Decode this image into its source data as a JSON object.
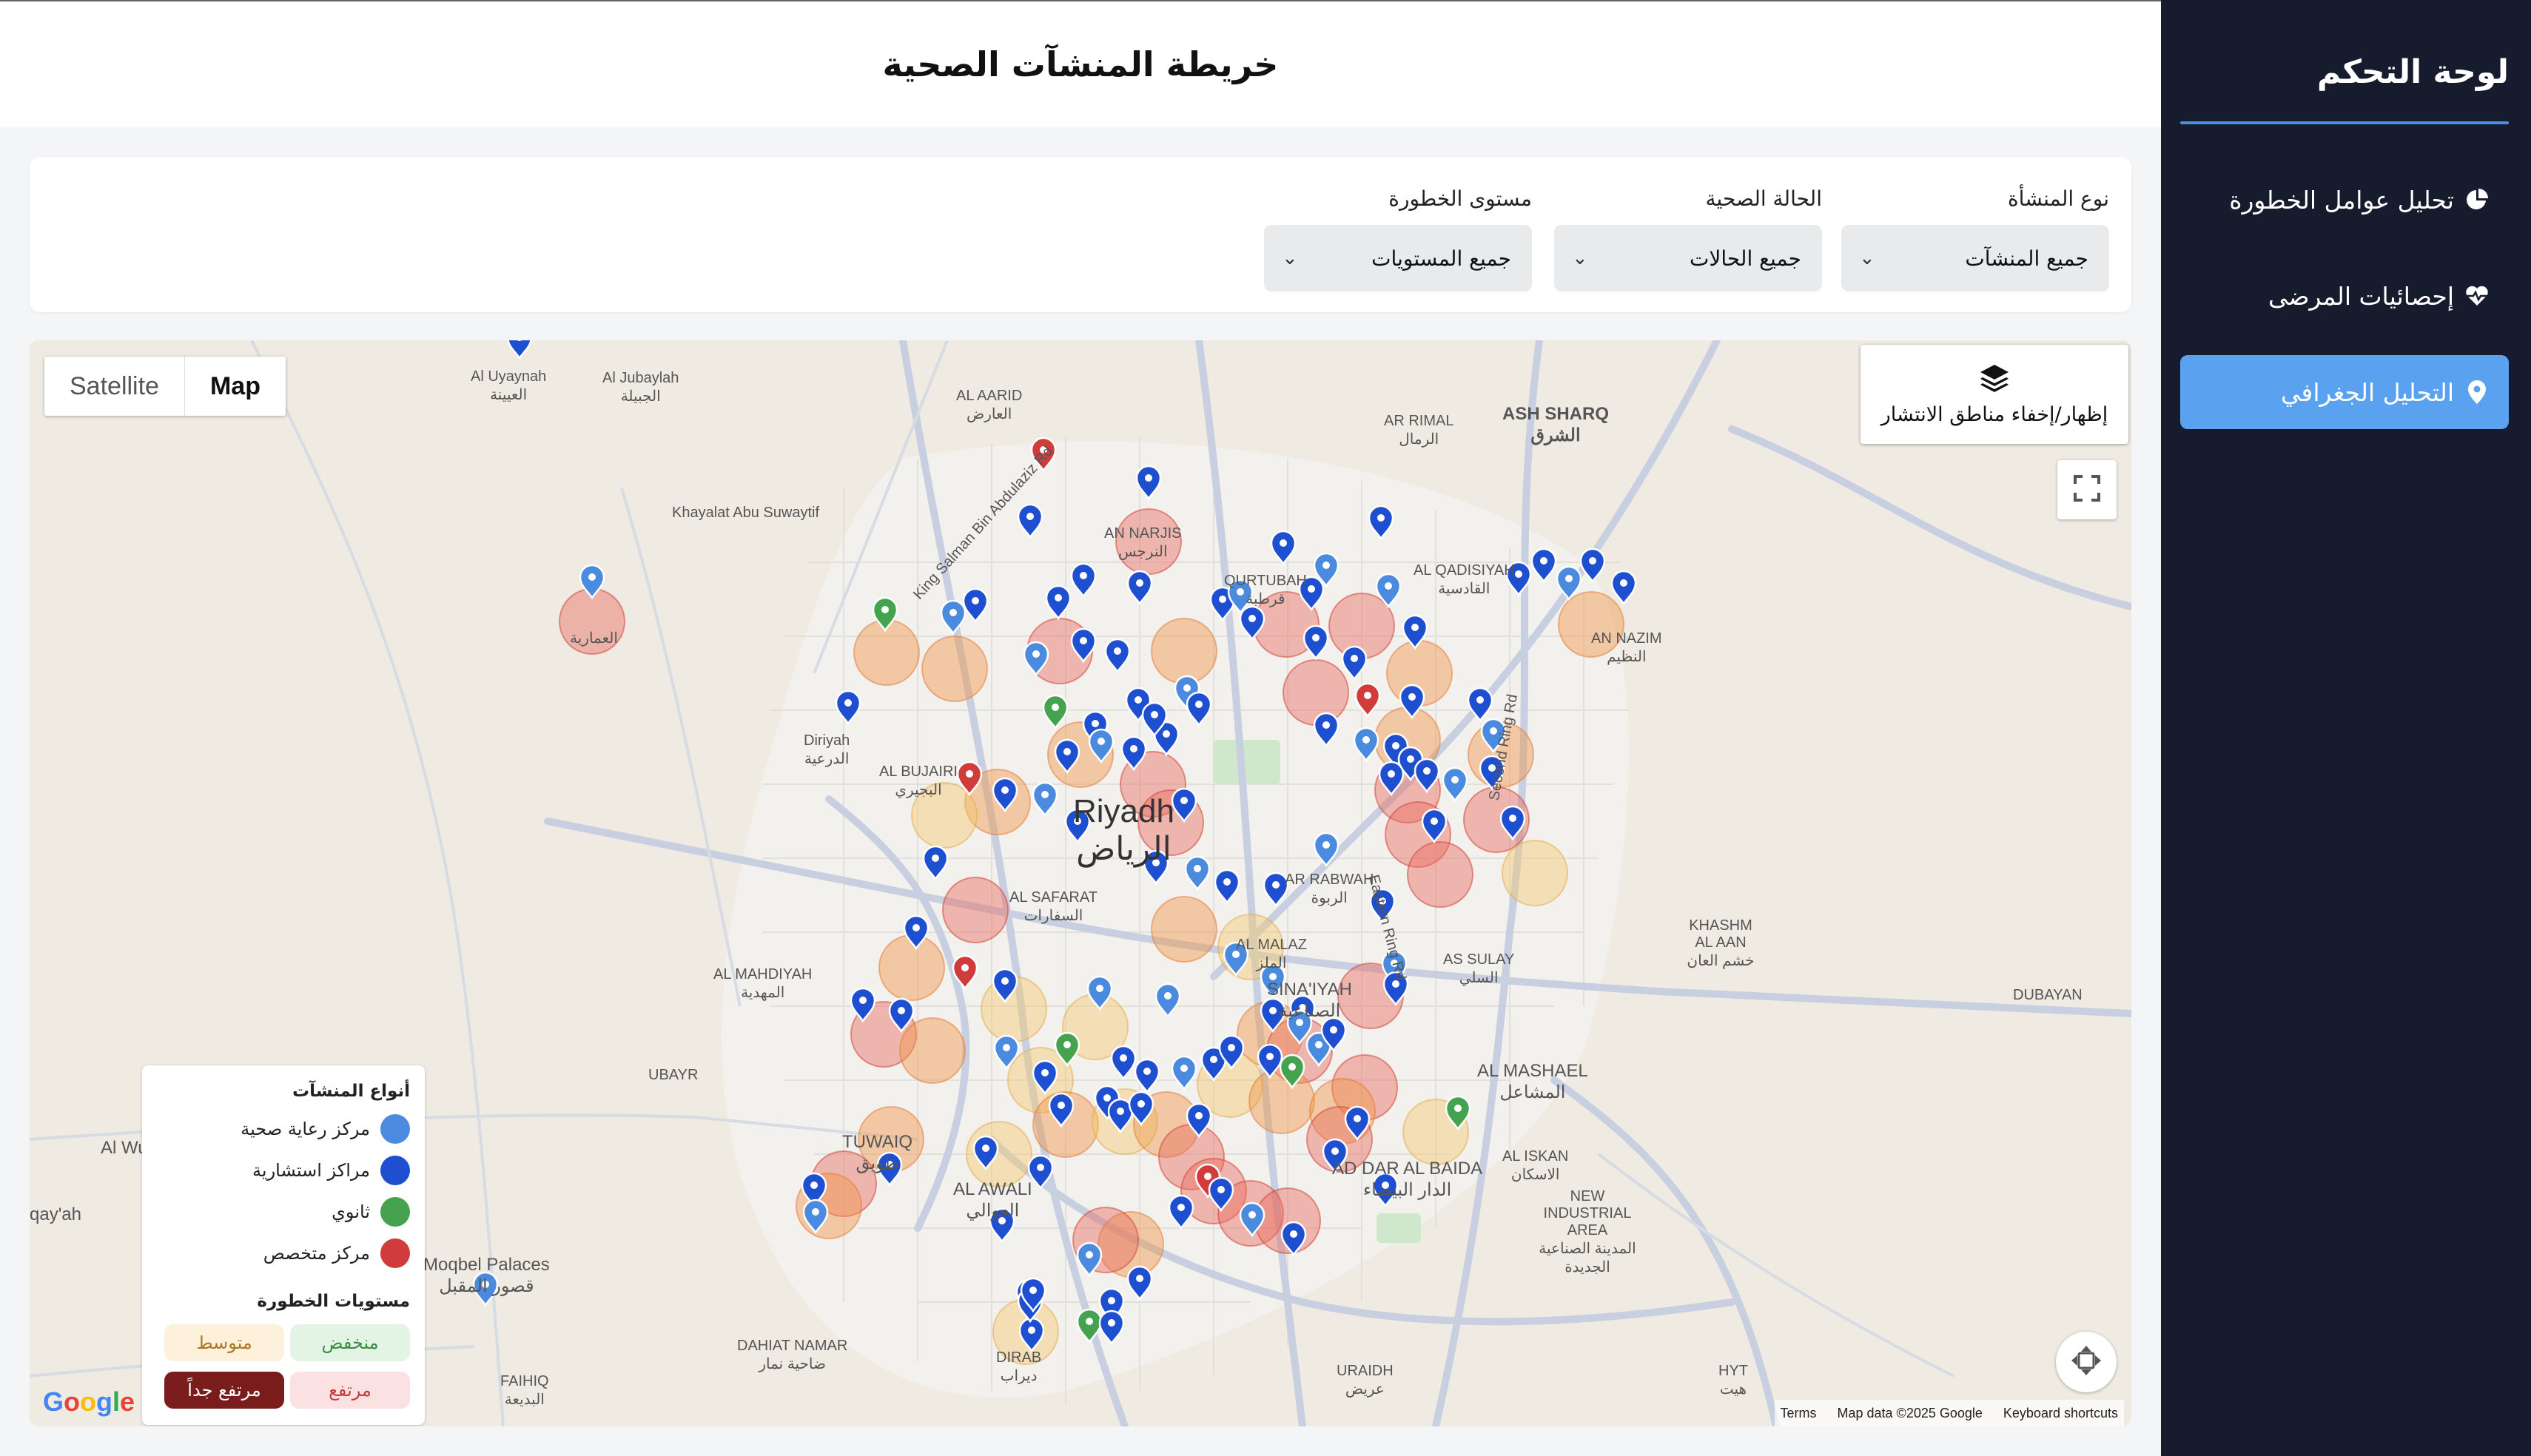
{
  "sidebar": {
    "title": "لوحة التحكم",
    "items": [
      {
        "label": "تحليل عوامل الخطورة",
        "icon": "pie-chart-icon",
        "active": false
      },
      {
        "label": "إحصائيات المرضى",
        "icon": "heart-pulse-icon",
        "active": false
      },
      {
        "label": "التحليل الجغرافي",
        "icon": "map-marker-icon",
        "active": true
      }
    ]
  },
  "header": {
    "title": "خريطة المنشآت الصحية"
  },
  "filters": {
    "facility_type": {
      "label": "نوع المنشأة",
      "value": "جميع المنشآت"
    },
    "health_status": {
      "label": "الحالة الصحية",
      "value": "جميع الحالات"
    },
    "risk_level": {
      "label": "مستوى الخطورة",
      "value": "جميع المستويات"
    }
  },
  "map": {
    "type_control": {
      "satellite": "Satellite",
      "map": "Map",
      "selected": "Map"
    },
    "heatmap_toggle": "إظهار/إخفاء مناطق الانتشار",
    "google_logo": "Google",
    "attribution": {
      "terms": "Terms",
      "data": "Map data ©2025 Google",
      "shortcuts": "Keyboard shortcuts"
    },
    "places": [
      {
        "name": "Riyadh",
        "ar": "الرياض",
        "big": true
      },
      {
        "name": "Diriyah",
        "ar": "الدرعية"
      },
      {
        "name": "AL AARID",
        "ar": "العارض"
      },
      {
        "name": "AN NARJIS",
        "ar": "النرجس"
      },
      {
        "name": "QURTUBAH",
        "ar": "قرطبة"
      },
      {
        "name": "AR RIMAL",
        "ar": "الرمال"
      },
      {
        "name": "ASH SHARQ",
        "ar": "الشرق"
      },
      {
        "name": "AL QADISIYAH",
        "ar": "القادسية"
      },
      {
        "name": "AN NAZIM",
        "ar": "النظيم"
      },
      {
        "name": "Khayalat Abu Suwaytif",
        "ar": ""
      },
      {
        "name": "Al Uyaynah",
        "ar": "العيينة"
      },
      {
        "name": "Al Jubaylah",
        "ar": "الجبيلة"
      },
      {
        "name": "AL BUJAIRI",
        "ar": "البجيري"
      },
      {
        "name": "AL SAFARAT",
        "ar": "السفارات"
      },
      {
        "name": "AR RABWAH",
        "ar": "الربوة"
      },
      {
        "name": "AL MALAZ",
        "ar": "الملز"
      },
      {
        "name": "AS SULAY",
        "ar": "السلي"
      },
      {
        "name": "KHASHM AL AAN",
        "ar": "خشم العان"
      },
      {
        "name": "DUBAYAN",
        "ar": ""
      },
      {
        "name": "AL MAHDIYAH",
        "ar": "المهدية"
      },
      {
        "name": "UBAYR",
        "ar": ""
      },
      {
        "name": "SINA'IYAH",
        "ar": "الصناعية"
      },
      {
        "name": "AL MASHAEL",
        "ar": "المشاعل"
      },
      {
        "name": "AL ISKAN",
        "ar": "الاسكان"
      },
      {
        "name": "NEW INDUSTRIAL AREA",
        "ar": "المدينة الصناعية الجديدة"
      },
      {
        "name": "AD DAR AL BAIDA",
        "ar": "الدار البيضاء"
      },
      {
        "name": "TUWAIQ",
        "ar": "طويق"
      },
      {
        "name": "AL AWALI",
        "ar": "العوالي"
      },
      {
        "name": "DAHIAT NAMAR",
        "ar": "ضاحية نمار"
      },
      {
        "name": "DIRAB",
        "ar": "ديراب"
      },
      {
        "name": "URAIDH",
        "ar": "عريض"
      },
      {
        "name": "HYT",
        "ar": "هيت"
      },
      {
        "name": "FAIHIQ",
        "ar": "البديعة"
      },
      {
        "name": "Moqbel Palaces",
        "ar": "قصور المقبل"
      },
      {
        "name": "qay'ah",
        "ar": ""
      },
      {
        "name": "Al Wu",
        "ar": ""
      },
      {
        "name": "AL AMMARIYAH",
        "ar": "العمارية"
      },
      {
        "name": "King Salman Bin Abdulaziz Rd",
        "ar": ""
      },
      {
        "name": "Second Ring Rd",
        "ar": ""
      },
      {
        "name": "Eastern Ring Rd",
        "ar": ""
      }
    ]
  },
  "legend": {
    "types_title": "أنواع المنشآت",
    "types": [
      {
        "label": "مركز رعاية صحية",
        "color": "#4a8be0"
      },
      {
        "label": "مراكز استشارية",
        "color": "#1f4fd1"
      },
      {
        "label": "ثانوي",
        "color": "#45a350"
      },
      {
        "label": "مركز متخصص",
        "color": "#d03b3b"
      }
    ],
    "risk_title": "مستويات الخطورة",
    "risk_levels": [
      {
        "label": "منخفض",
        "bg": "#e3f4e4",
        "fg": "#3c8c45"
      },
      {
        "label": "متوسط",
        "bg": "#fdf1dc",
        "fg": "#b07520"
      },
      {
        "label": "مرتفع",
        "bg": "#fbe1e1",
        "fg": "#c23b3b"
      },
      {
        "label": "مرتفع جداً",
        "bg": "#7b1c1c",
        "fg": "#ffffff"
      }
    ]
  }
}
